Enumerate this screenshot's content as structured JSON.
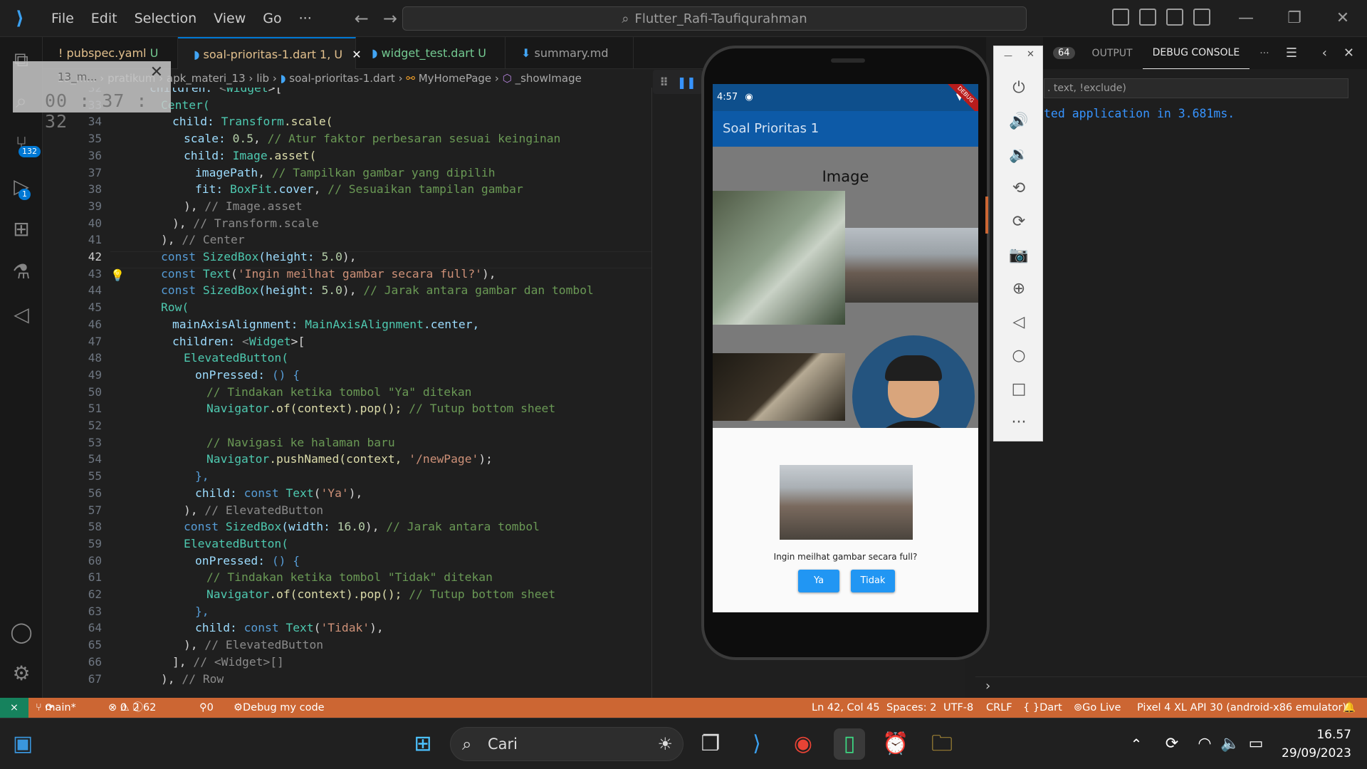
{
  "titlebar": {
    "menus": [
      "File",
      "Edit",
      "Selection",
      "View",
      "Go",
      "···"
    ],
    "search_text": "Flutter_Rafi-Taufiqurahman"
  },
  "tabs": [
    {
      "icon": "!",
      "label": "pubspec.yaml",
      "status": "U"
    },
    {
      "icon": "flutter",
      "label": "soal-prioritas-1.dart",
      "status": "1, U",
      "active": true
    },
    {
      "icon": "flutter",
      "label": "widget_test.dart",
      "status": "U"
    },
    {
      "icon": "md",
      "label": "summary.md",
      "status": ""
    }
  ],
  "breadcrumb": {
    "p1": "13_m...",
    "p2": "pratikum",
    "p3": "apk_materi_13",
    "p4": "lib",
    "p5": "soal-prioritas-1.dart",
    "p6": "MyHomePage",
    "p7": "_showImage"
  },
  "timer": {
    "time": "00 : 37 : 32"
  },
  "badges": {
    "scm": "132",
    "debug": "1"
  },
  "editor": {
    "line_numbers": [
      "32",
      "33",
      "34",
      "35",
      "36",
      "37",
      "38",
      "39",
      "40",
      "41",
      "42",
      "43",
      "44",
      "45",
      "46",
      "47",
      "48",
      "49",
      "50",
      "51",
      "52",
      "53",
      "54",
      "55",
      "56",
      "57",
      "58",
      "59",
      "60",
      "61",
      "62",
      "63",
      "64",
      "65",
      "66",
      "67"
    ],
    "current_line": "42"
  },
  "code": {
    "l32a": "children: ",
    "l32b": "<",
    "l32c": "Widget",
    "l32d": ">[",
    "l33": "Center(",
    "l34a": "child: ",
    "l34b": "Transform",
    "l34c": ".scale(",
    "l35a": "scale: ",
    "l35b": "0.5",
    "l35c": ", ",
    "l35d": "// Atur faktor perbesaran sesuai keinginan",
    "l36a": "child: ",
    "l36b": "Image",
    "l36c": ".asset(",
    "l37a": "imagePath",
    "l37b": ", ",
    "l37c": "// Tampilkan gambar yang dipilih",
    "l38a": "fit: ",
    "l38b": "BoxFit",
    "l38c": ".cover",
    "l38d": ", ",
    "l38e": "// Sesuaikan tampilan gambar",
    "l39a": "), ",
    "l39b": "// Image.asset",
    "l40a": "), ",
    "l40b": "// Transform.scale",
    "l41a": "), ",
    "l41b": "// Center",
    "l42a": "const ",
    "l42b": "SizedBox",
    "l42c": "(height: ",
    "l42d": "5.0",
    "l42e": "),",
    "l43a": "const ",
    "l43b": "Text",
    "l43c": "(",
    "l43d": "'Ingin meilhat gambar secara full?'",
    "l43e": "),",
    "l44a": "const ",
    "l44b": "SizedBox",
    "l44c": "(height: ",
    "l44d": "5.0",
    "l44e": "), ",
    "l44f": "// Jarak antara gambar dan tombol",
    "l45": "Row(",
    "l46a": "mainAxisAlignment: ",
    "l46b": "MainAxisAlignment",
    "l46c": ".center,",
    "l47a": "children: ",
    "l47b": "<",
    "l47c": "Widget",
    "l47d": ">[",
    "l48": "ElevatedButton(",
    "l49a": "onPressed: ",
    "l49b": "() {",
    "l50": "// Tindakan ketika tombol \"Ya\" ditekan",
    "l51a": "Navigator",
    "l51b": ".of(context).pop(); ",
    "l51c": "// Tutup bottom sheet",
    "l53": "// Navigasi ke halaman baru",
    "l54a": "Navigator",
    "l54b": ".pushNamed(context, ",
    "l54c": "'/newPage'",
    "l54d": ");",
    "l55": "},",
    "l56a": "child: ",
    "l56b": "const ",
    "l56c": "Text",
    "l56d": "(",
    "l56e": "'Ya'",
    "l56f": "),",
    "l57a": "), ",
    "l57b": "// ElevatedButton",
    "l58a": "const ",
    "l58b": "SizedBox",
    "l58c": "(width: ",
    "l58d": "16.0",
    "l58e": "), ",
    "l58f": "// Jarak antara tombol",
    "l59": "ElevatedButton(",
    "l60a": "onPressed: ",
    "l60b": "() {",
    "l61": "// Tindakan ketika tombol \"Tidak\" ditekan",
    "l62a": "Navigator",
    "l62b": ".of(context).pop(); ",
    "l62c": "// Tutup bottom sheet",
    "l63": "},",
    "l64a": "child: ",
    "l64b": "const ",
    "l64c": "Text",
    "l64d": "(",
    "l64e": "'Tidak'",
    "l64f": "),",
    "l65a": "), ",
    "l65b": "// ElevatedButton",
    "l66a": "], ",
    "l66b": "// <Widget>[]",
    "l67a": "), ",
    "l67b": "// Row"
  },
  "phone": {
    "time": "4:57",
    "debug_ribbon": "DEBUG",
    "appbar_title": "Soal Prioritas 1",
    "image_title": "Image",
    "sheet_question": "Ingin meilhat gambar secara full?",
    "btn_yes": "Ya",
    "btn_no": "Tidak"
  },
  "panel": {
    "count": "64",
    "tab_output": "OUTPUT",
    "tab_debug": "DEBUG CONSOLE",
    "filter": ". text, !exclude)",
    "console_line": "ted application in 3.681ms."
  },
  "status": {
    "branch": "main*",
    "errors": "0",
    "warnings": "2",
    "infos": "62",
    "ports": "0",
    "debug": "Debug my code",
    "position": "Ln 42, Col 45",
    "spaces": "Spaces: 2",
    "encoding": "UTF-8",
    "eol": "CRLF",
    "lang": "Dart",
    "golive": "Go Live",
    "device": "Pixel 4 XL API 30 (android-x86 emulator)"
  },
  "taskbar": {
    "search_label": "Cari",
    "time": "16.57",
    "date": "29/09/2023"
  },
  "colors": {
    "accent": "#0078d4",
    "status_bar": "#cc6633",
    "flutter_blue": "#2196f3"
  }
}
